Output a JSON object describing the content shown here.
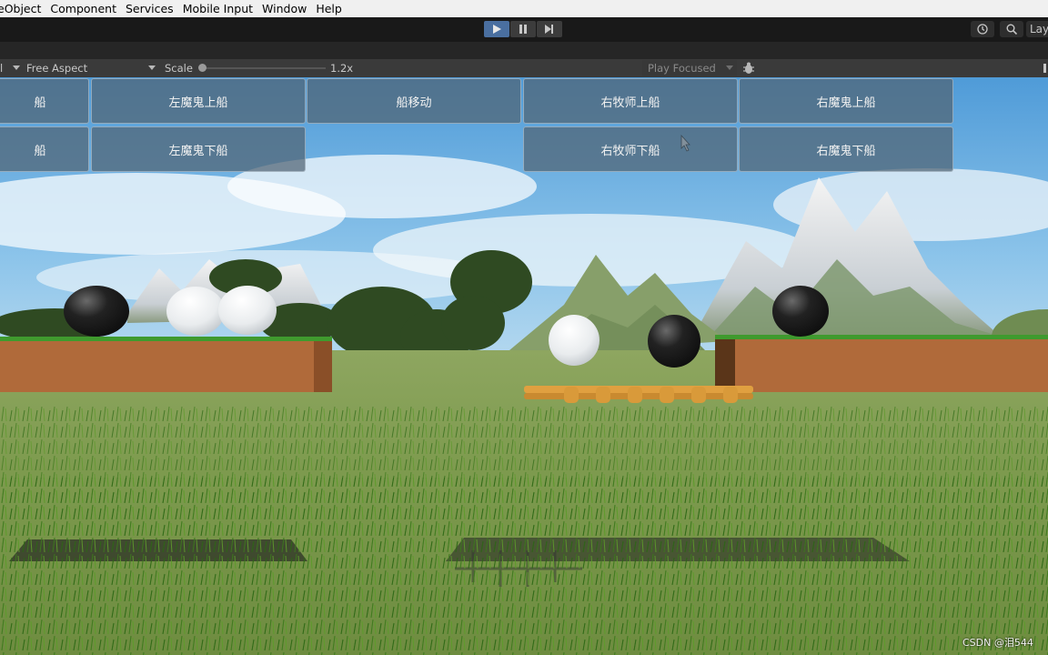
{
  "menubar": {
    "items": [
      "eObject",
      "Component",
      "Services",
      "Mobile Input",
      "Window",
      "Help"
    ]
  },
  "toolbar": {
    "play_icon": "play-icon",
    "pause_icon": "pause-icon",
    "step_icon": "step-icon",
    "layers_label": "Lay"
  },
  "game_view_bar": {
    "display_fragment": "l",
    "aspect": "Free Aspect",
    "scale_label": "Scale",
    "scale_value": "1.2x",
    "play_mode": "Play Focused"
  },
  "game_buttons": {
    "row1": [
      "船",
      "左魔鬼上船",
      "船移动",
      "右牧师上船",
      "右魔鬼上船"
    ],
    "row2": [
      "船",
      "左魔鬼下船",
      "右牧师下船",
      "右魔鬼下船"
    ]
  },
  "watermark": "CSDN @泪544",
  "colors": {
    "menubar_bg": "#f0f0f0",
    "toolbar_bg": "#191919",
    "play_active": "#4a6fa0",
    "sky": "#6aaee0",
    "grass": "#7a9a4a",
    "bank_dirt": "#b06a3a",
    "boat_wood": "#d99a3a"
  }
}
